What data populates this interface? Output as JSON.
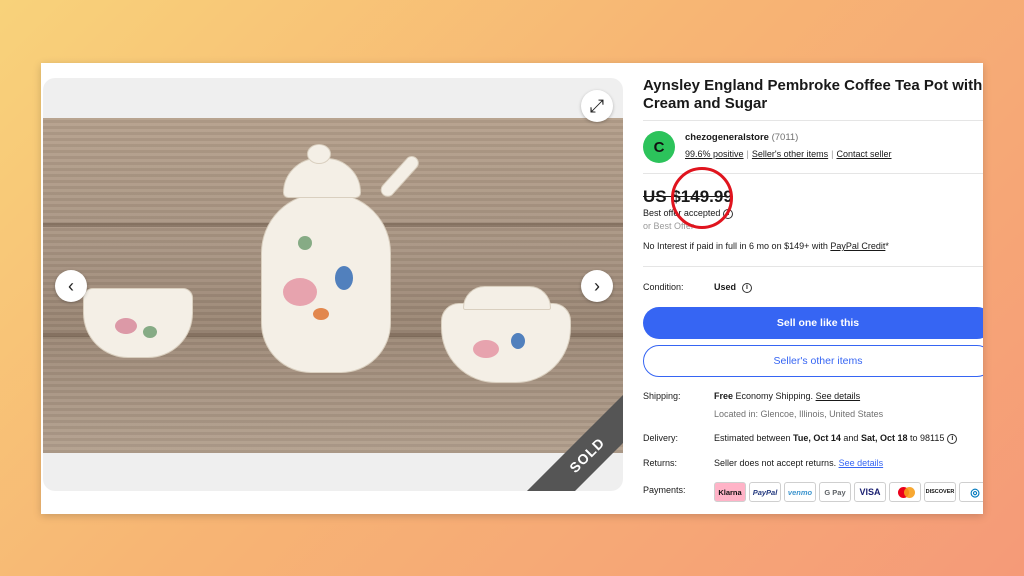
{
  "gallery": {
    "expand_icon": "expand-icon",
    "prev_icon": "chevron-left-icon",
    "next_icon": "chevron-right-icon",
    "sold_label": "SOLD"
  },
  "listing": {
    "title": "Aynsley England Pembroke Coffee Tea Pot with Cream and Sugar",
    "seller": {
      "avatar_letter": "C",
      "name": "chezogeneralstore",
      "feedback_count": "(7011)",
      "positive": "99.6% positive",
      "other_items": "Seller's other items",
      "contact": "Contact seller"
    },
    "price": "US $149.99",
    "best_offer_accepted": "Best offer accepted",
    "or_best_offer": "or Best Offer",
    "financing": {
      "text": "No Interest if paid in full in 6 mo on $149+ with ",
      "link": "PayPal Credit",
      "suffix": "*"
    },
    "condition": {
      "label": "Condition:",
      "value": "Used"
    },
    "buttons": {
      "sell_one": "Sell one like this",
      "sellers_other_items": "Seller's other items"
    },
    "shipping": {
      "label": "Shipping:",
      "free": "Free",
      "method": " Economy Shipping. ",
      "details_link": "See details",
      "location": "Located in: Glencoe, Illinois, United States"
    },
    "delivery": {
      "label": "Delivery:",
      "prefix": "Estimated between ",
      "start": "Tue, Oct 14",
      "and": " and ",
      "end": "Sat, Oct 18",
      "to": " to 98115"
    },
    "returns": {
      "label": "Returns:",
      "text": "Seller does not accept returns. ",
      "details_link": "See details"
    },
    "payments": {
      "label": "Payments:",
      "methods": [
        "Klarna",
        "PayPal",
        "venmo",
        "G Pay",
        "VISA",
        "Mastercard",
        "DISCOVER",
        "Diners"
      ]
    }
  },
  "colors": {
    "primary_blue": "#3665f3",
    "annotation_red": "#e0141e",
    "avatar_green": "#2cc35b"
  }
}
